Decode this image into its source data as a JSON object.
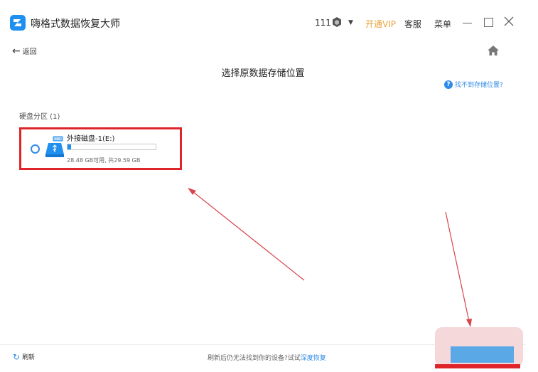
{
  "window": {
    "app_title": "嗨格式数据恢复大师",
    "user_number": "111",
    "vip_label": "开通VIP",
    "service_label": "客服",
    "menu_label": "菜单",
    "accent_color": "#1f8ff0"
  },
  "nav": {
    "back_label": "返回",
    "home_icon": "home-icon"
  },
  "main": {
    "title": "选择原数据存储位置",
    "help_link": "找不到存储位置?",
    "section_label": "硬盘分区 (1)",
    "disks": [
      {
        "name": "外接磁盘-1(E:)",
        "used_fraction": 0.04,
        "size_text": "28.48 GB可用, 共29.59 GB",
        "selected": false
      }
    ]
  },
  "footer": {
    "refresh_label": "刷新",
    "tip_text": "刷新后仍无法找到你的设备?试试",
    "tip_link": "深度恢复"
  },
  "annotation_color": "#e0252a"
}
